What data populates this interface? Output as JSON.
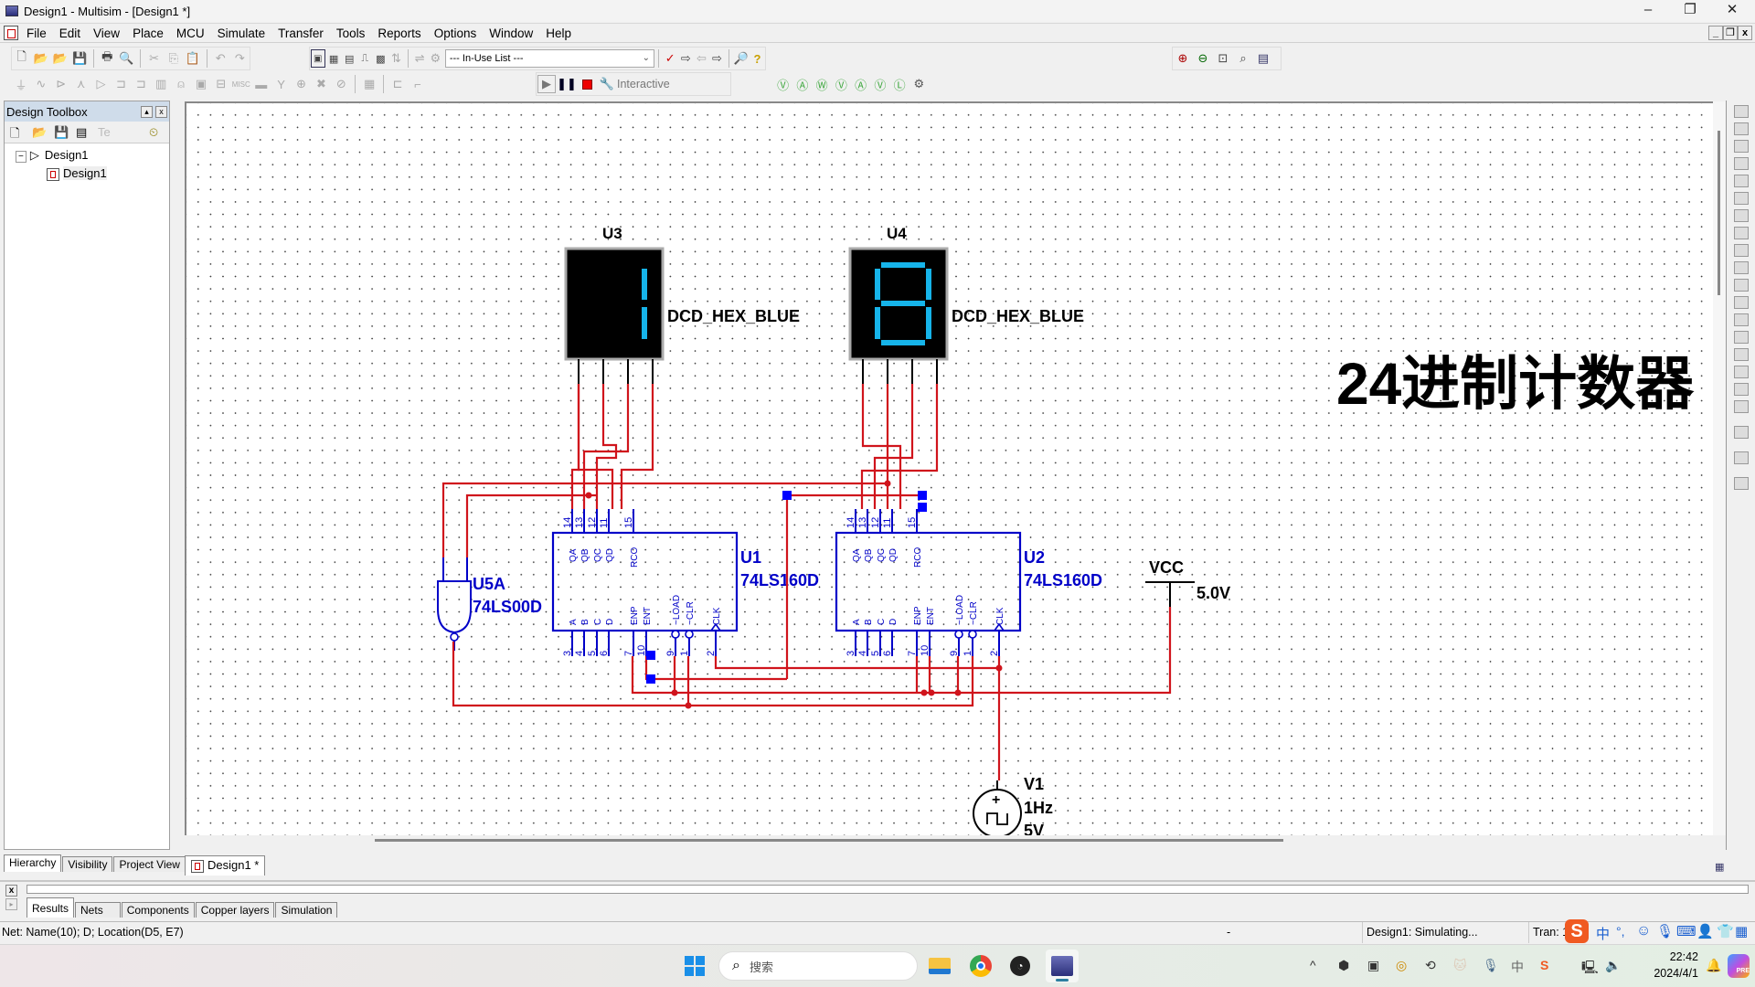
{
  "window": {
    "title": "Design1 - Multisim - [Design1 *]",
    "minimize": "–",
    "maximize": "❐",
    "close": "✕"
  },
  "menu": {
    "items": [
      "File",
      "Edit",
      "View",
      "Place",
      "MCU",
      "Simulate",
      "Transfer",
      "Tools",
      "Reports",
      "Options",
      "Window",
      "Help"
    ]
  },
  "toolbar": {
    "in_use_list": "--- In-Use List ---",
    "interactive_label": "Interactive",
    "icons_row1": [
      "new-icon",
      "open-icon",
      "open-sample-icon",
      "save-icon",
      "print-icon",
      "print-preview-icon",
      "cut-icon",
      "copy-icon",
      "paste-icon",
      "undo-icon",
      "redo-icon"
    ],
    "view_icons": [
      "toggle-design-toolbox-icon",
      "spreadsheet-view-icon",
      "grapher-icon",
      "postprocessor-icon",
      "database-manager-icon",
      "component-wizard-icon"
    ],
    "zoom_icons": [
      "zoom-in-icon",
      "zoom-out-icon",
      "zoom-area-icon",
      "zoom-fit-icon",
      "full-screen-icon"
    ]
  },
  "toolbox": {
    "title": "Design Toolbox",
    "tree": [
      {
        "label": "Design1",
        "level": 0
      },
      {
        "label": "Design1",
        "level": 1
      }
    ],
    "tabs": [
      "Hierarchy",
      "Visibility",
      "Project View"
    ]
  },
  "schematic": {
    "heading": "24进制计数器",
    "displays": [
      {
        "ref": "U3",
        "model": "DCD_HEX_BLUE",
        "digit": "1"
      },
      {
        "ref": "U4",
        "model": "DCD_HEX_BLUE",
        "digit": "8"
      }
    ],
    "counters": [
      {
        "ref": "U1",
        "model": "74LS160D"
      },
      {
        "ref": "U2",
        "model": "74LS160D"
      }
    ],
    "gate": {
      "ref": "U5A",
      "model": "74LS00D"
    },
    "pins_top": [
      {
        "num": "14",
        "name": "QA"
      },
      {
        "num": "13",
        "name": "QB"
      },
      {
        "num": "12",
        "name": "QC"
      },
      {
        "num": "11",
        "name": "QD"
      },
      {
        "num": "15",
        "name": "RCO"
      }
    ],
    "pins_bottom": [
      {
        "num": "3",
        "name": "A"
      },
      {
        "num": "4",
        "name": "B"
      },
      {
        "num": "5",
        "name": "C"
      },
      {
        "num": "6",
        "name": "D"
      },
      {
        "num": "7",
        "name": "ENP"
      },
      {
        "num": "10",
        "name": "ENT"
      },
      {
        "num": "9",
        "name": "~LOAD"
      },
      {
        "num": "1",
        "name": "~CLR"
      },
      {
        "num": "2",
        "name": "CLK"
      }
    ],
    "vcc": {
      "label": "VCC",
      "value": "5.0V"
    },
    "source": {
      "ref": "V1",
      "freq": "1Hz",
      "amp": "5V"
    },
    "colors": {
      "wire": "#d0141c",
      "component": "#0000c8",
      "segment": "#16b4ea",
      "junction": "#0000ff"
    }
  },
  "doc_tab": "Design1 *",
  "results_tabs": [
    "Results",
    "Nets",
    "Components",
    "Copper layers",
    "Simulation"
  ],
  "status": {
    "left": "Net: Name(10); D; Location(D5, E7)",
    "middle": "-",
    "sim": "Design1: Simulating...",
    "tran": "Tran: 1"
  },
  "taskbar": {
    "search_placeholder": "搜索",
    "time": "22:42",
    "date": "2024/4/1",
    "ime": "中"
  }
}
